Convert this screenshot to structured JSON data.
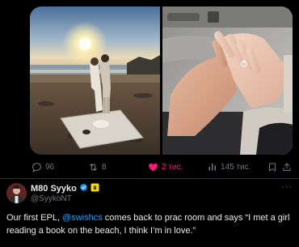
{
  "media": {
    "left_photo": "beach-couple-sunset-photo",
    "right_photo": "holding-hands-ring-car-photo"
  },
  "actions": {
    "reply_count": "96",
    "repost_count": "8",
    "like_count": "2 тис.",
    "views_count": "145 тис."
  },
  "quoted_author": {
    "name": "M80 Syyko",
    "handle": "@SyykoNT"
  },
  "tweet": {
    "text_before": "Our first EPL, ",
    "mention": "@swishcs",
    "text_after": " comes back to prac room and says “I met a girl reading a book on the beach, I think I’m in love.”"
  },
  "colors": {
    "background": "#000000",
    "text": "#e7e9ea",
    "secondary": "#71767b",
    "like": "#f91880",
    "link": "#1d9bf0",
    "verified": "#1d9bf0",
    "affiliate": "#f5d800"
  },
  "icons": {
    "reply": "reply-icon",
    "repost": "repost-icon",
    "like": "heart-filled-icon",
    "views": "views-bar-icon",
    "bookmark": "bookmark-icon",
    "share": "share-icon",
    "verified": "verified-badge-icon",
    "affiliate": "affiliate-badge-icon",
    "more": "more-dots-icon"
  }
}
